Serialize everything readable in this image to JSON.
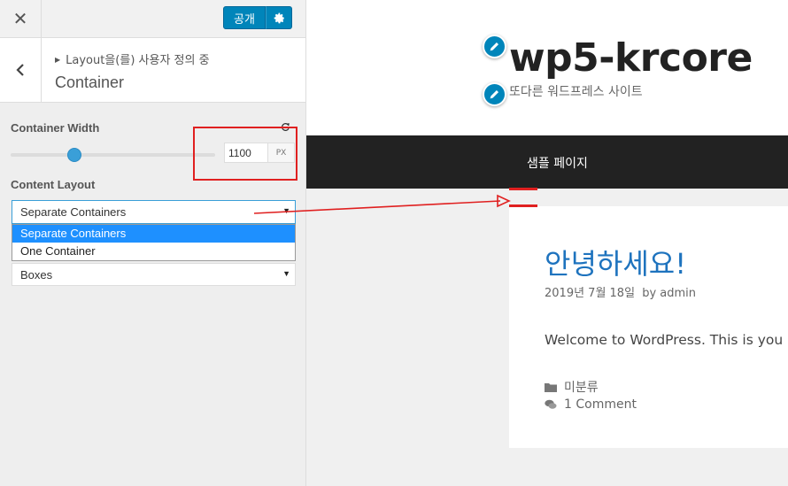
{
  "header": {
    "close_glyph": "✕",
    "publish_label": "공개"
  },
  "section": {
    "breadcrumb": "Layout을(를) 사용자 정의 중",
    "title": "Container"
  },
  "container_width": {
    "label": "Container Width",
    "value": "1100",
    "unit": "PX",
    "slider_fraction": 0.31
  },
  "content_layout": {
    "label": "Content Layout",
    "selected": "Separate Containers",
    "options": [
      "Separate Containers",
      "One Container"
    ],
    "second_select_value": "Boxes"
  },
  "preview": {
    "site_title": "wp5-krcore",
    "site_description": "또다른 워드프레스 사이트",
    "nav_item": "샘플 페이지",
    "post": {
      "title": "안녕하세요!",
      "date": "2019년 7월 18일",
      "by": "by",
      "author": "admin",
      "excerpt": "Welcome to WordPress. This is you",
      "category": "미분류",
      "comments": "1 Comment"
    }
  },
  "colors": {
    "accent": "#0085ba",
    "highlight": "#e02020",
    "link": "#1e73be",
    "nav_bg": "#222222"
  },
  "icons": [
    "close-icon",
    "gear-icon",
    "chevron-left-icon",
    "reset-icon",
    "pencil-icon",
    "folder-icon",
    "comments-icon"
  ]
}
